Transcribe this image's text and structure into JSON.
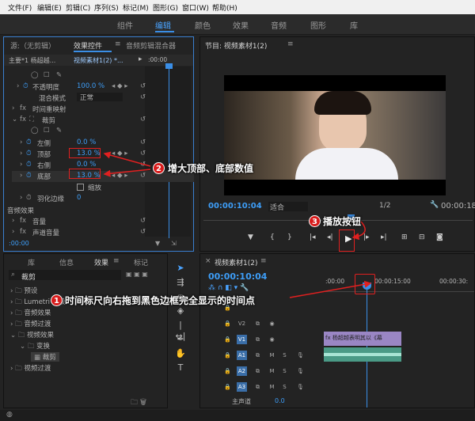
{
  "menu": [
    "文件(F)",
    "编辑(E)",
    "剪辑(C)",
    "序列(S)",
    "标记(M)",
    "图形(G)",
    "窗口(W)",
    "帮助(H)"
  ],
  "workspaces": [
    "组件",
    "编辑",
    "颜色",
    "效果",
    "音频",
    "图形",
    "库"
  ],
  "effect_panel": {
    "tab_source": "源:（无剪辑）",
    "tab_effects": "效果控件",
    "tab_audio": "音频剪辑混合器",
    "master": "主要*1 杨超越...",
    "clip": "视频素材1(2) *...",
    "timecode_start": ":00:00",
    "opacity": "不透明度",
    "opacity_val": "100.0 %",
    "blend": "混合模式",
    "blend_val": "正常",
    "time_remap": "时间重映射",
    "crop": "裁剪",
    "left": "左侧",
    "left_val": "0.0 %",
    "top": "顶部",
    "top_val": "13.0 %",
    "right": "右侧",
    "right_val": "0.0 %",
    "bottom": "底部",
    "bottom_val": "13.0 %",
    "zoom": "缩放",
    "feather": "羽化边缘",
    "feather_val": "0",
    "audio_fx": "音频效果",
    "volume": "音量",
    "channel": "声道音量"
  },
  "program": {
    "title": "节目: 视频素材1(2)",
    "timecode": "00:00:10:04",
    "fit": "适合",
    "ratio": "1/2",
    "timecode_end": "00:00:18"
  },
  "project": {
    "tabs": [
      "库",
      "信息",
      "效果",
      "标记"
    ],
    "search": "裁剪",
    "items": [
      "预设",
      "Lumetri 预设",
      "音频效果",
      "音频过渡",
      "视频效果",
      "变换",
      "裁剪",
      "视频过渡"
    ]
  },
  "timeline": {
    "tab": "视频素材1(2)",
    "timecode": "00:00:10:04",
    "ruler": [
      ":00:00",
      "00:00:15:00",
      "00:00:30:"
    ],
    "tracks": [
      "V2",
      "V1",
      "A1",
      "A2",
      "A3"
    ],
    "clip": "杨超越表明其以《幕",
    "master": "主声道",
    "master_val": "0.0",
    "m": "M",
    "s": "S"
  },
  "callouts": {
    "c1": "时间标尺向右拖到黑色边框完全显示的时间点",
    "c2": "增大顶部、底部数值",
    "c3": "播放按钮"
  },
  "numbers": [
    "1",
    "2",
    "3"
  ]
}
